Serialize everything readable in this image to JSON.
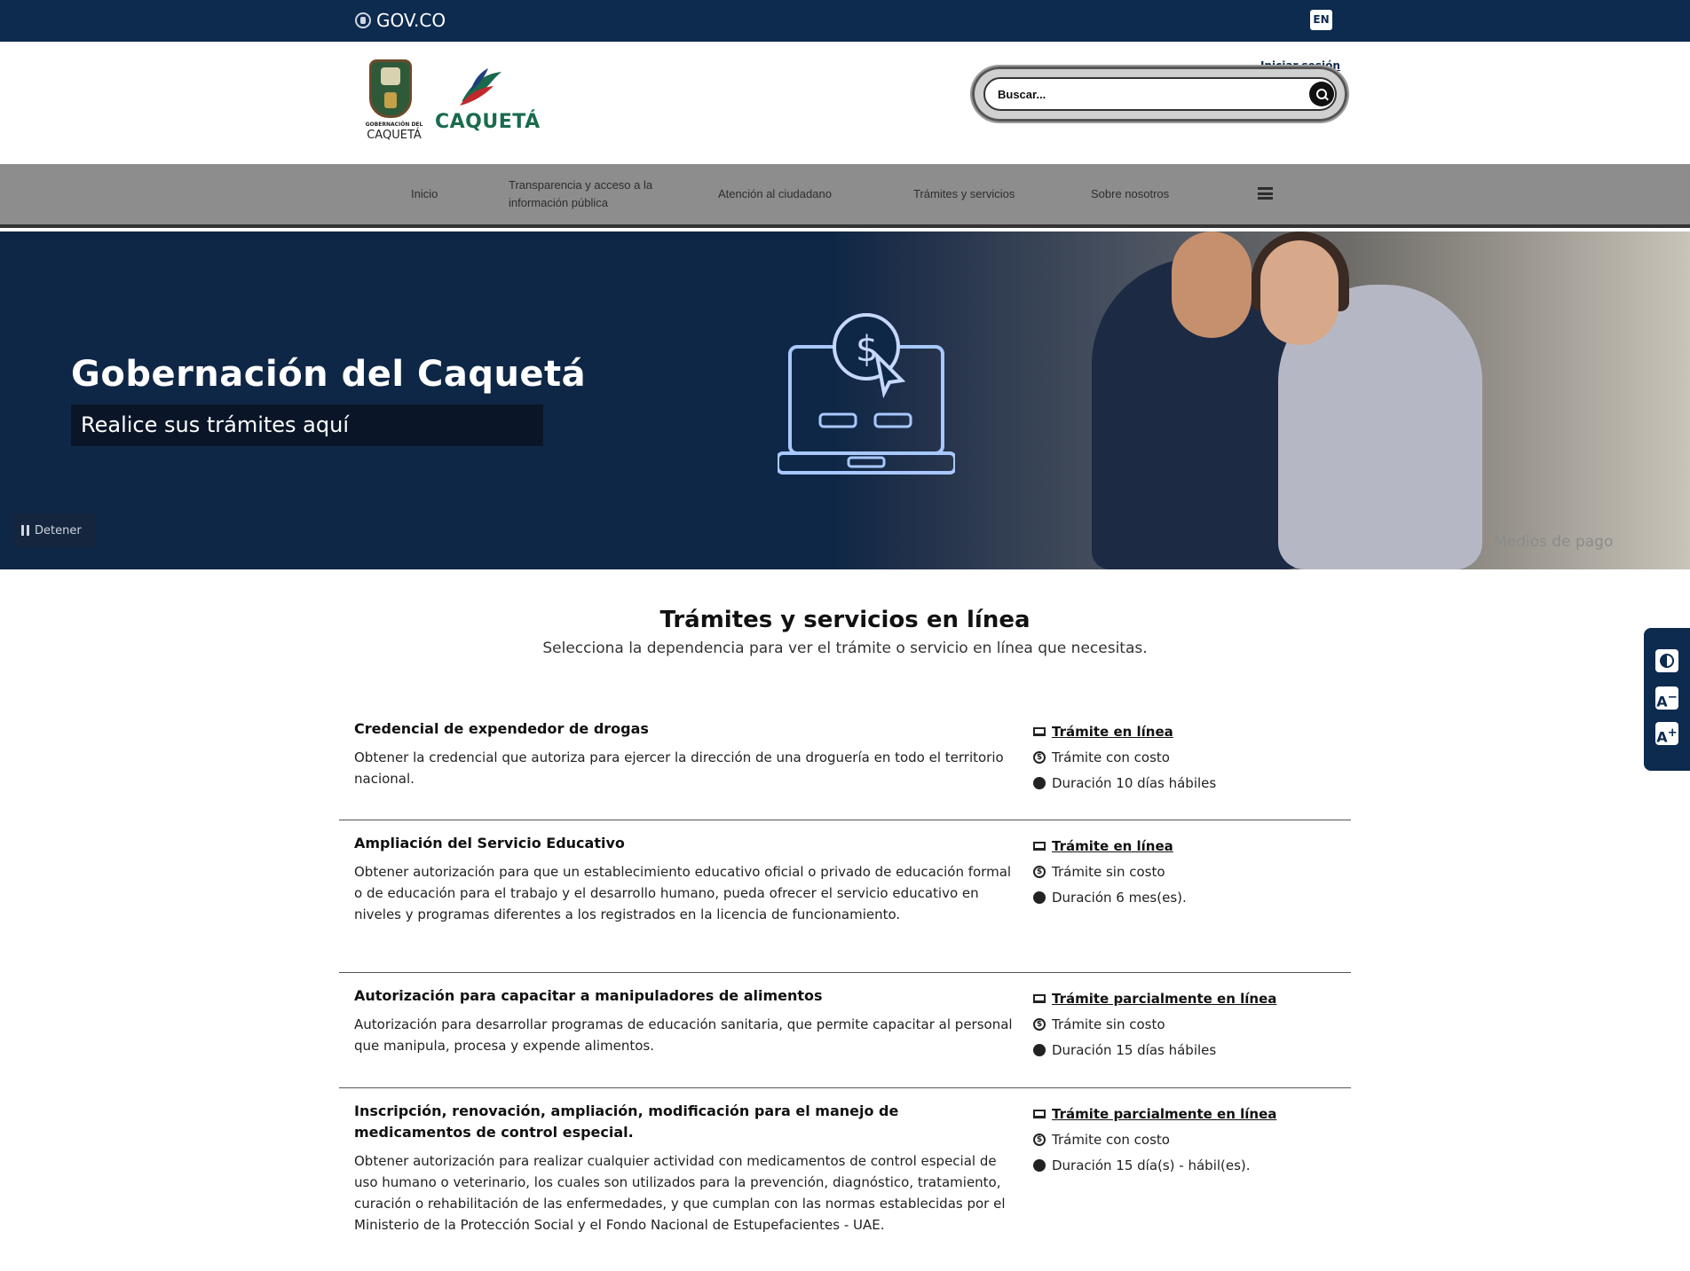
{
  "govbar": {
    "brand": "GOV.CO",
    "lang": "EN"
  },
  "header": {
    "logo1_small": "GOBERNACIÓN DEL",
    "logo1_big": "CAQUETÁ",
    "logo2_word": "CAQUETÁ",
    "login": "Iniciar sesión",
    "search_placeholder": "Buscar..."
  },
  "nav": {
    "items": [
      {
        "label": "Inicio"
      },
      {
        "label": "Transparencia y acceso a la información pública"
      },
      {
        "label": "Atención al ciudadano"
      },
      {
        "label": "Trámites y servicios"
      },
      {
        "label": "Sobre nosotros"
      }
    ]
  },
  "hero": {
    "title": "Gobernación del Caquetá",
    "subtitle": "Realice sus trámites aquí",
    "pause_label": "Detener",
    "caption": "Medios de pago"
  },
  "section": {
    "title": "Trámites y servicios en línea",
    "subtitle": "Selecciona la dependencia para ver el trámite o servicio en línea que necesitas."
  },
  "items": [
    {
      "name": "Credencial de expendedor de drogas",
      "desc": "Obtener la credencial que autoriza para ejercer la dirección de una droguería en todo el territorio nacional.",
      "mode": "Trámite en línea",
      "cost": "Trámite con costo",
      "duration": "Duración 10 días hábiles"
    },
    {
      "name": "Ampliación del Servicio Educativo",
      "desc": "Obtener autorización para que un establecimiento educativo oficial o privado de educación formal o de educación para el trabajo y el desarrollo humano, pueda ofrecer el servicio educativo en niveles y programas diferentes a los registrados en la licencia de funcionamiento.",
      "mode": "Trámite en línea",
      "cost": "Trámite sin costo",
      "duration": "Duración 6 mes(es)."
    },
    {
      "name": "Autorización para capacitar a manipuladores de alimentos",
      "desc": "Autorización para desarrollar programas de educación sanitaria, que permite capacitar al personal que manipula, procesa y expende alimentos.",
      "mode": "Trámite parcialmente en línea",
      "cost": "Trámite sin costo",
      "duration": "Duración 15 días hábiles"
    },
    {
      "name": "Inscripción, renovación, ampliación, modificación para el manejo de medicamentos de control especial.",
      "desc": "Obtener autorización para realizar cualquier actividad con medicamentos de control especial de uso humano o veterinario, los cuales son utilizados para la prevención, diagnóstico, tratamiento, curación o rehabilitación de las enfermedades, y que cumplan con las normas establecidas por el Ministerio de la Protección Social y el Fondo Nacional de Estupefacientes - UAE.",
      "mode": "Trámite parcialmente en línea",
      "cost": "Trámite con costo",
      "duration": "Duración 15 día(s) - hábil(es)."
    }
  ],
  "a11y": {
    "font_down": "A",
    "font_up": "A"
  },
  "colors": {
    "topbar": "#0d2a4f",
    "nav": "#8d8d8d",
    "hero": "#0f2746"
  }
}
